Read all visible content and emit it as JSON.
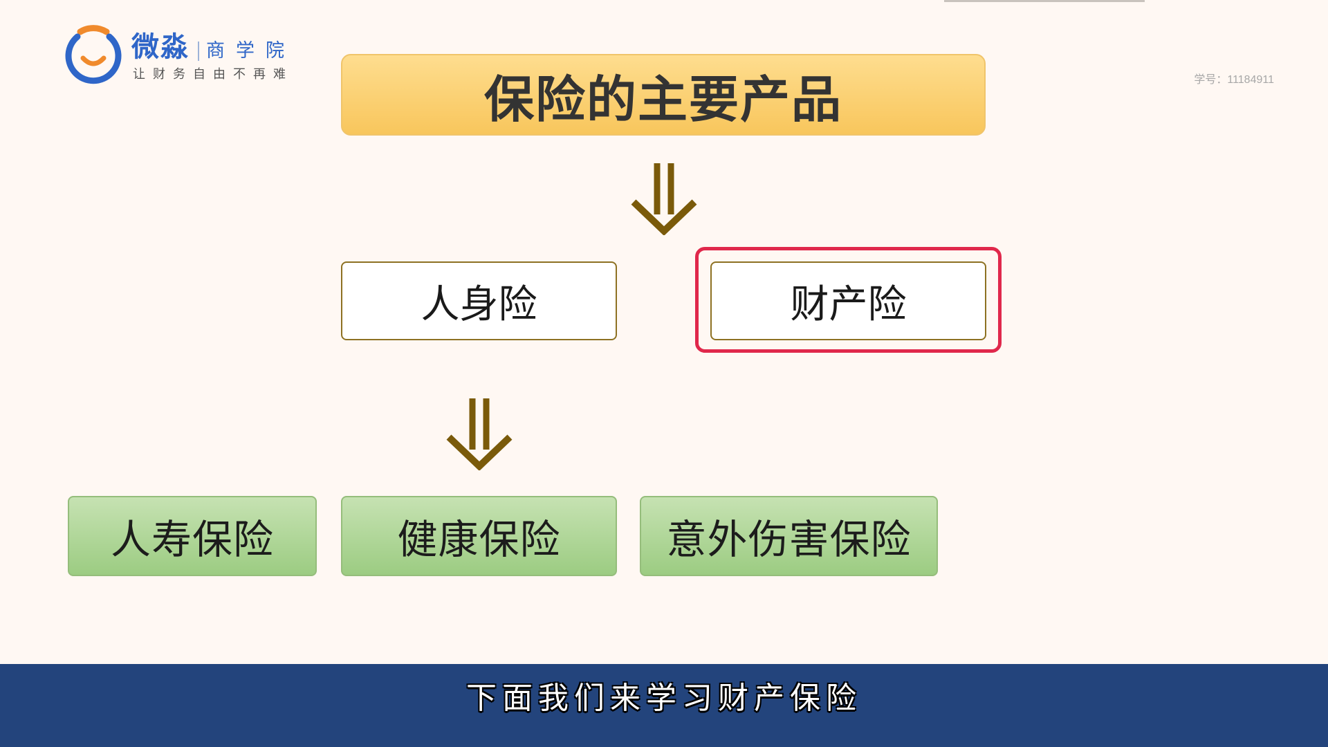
{
  "logo": {
    "name": "微淼",
    "sub": "商学院",
    "tagline": "让财务自由不再难",
    "colors": {
      "blue": "#2f66c8",
      "orange": "#f08a2c",
      "red": "#e8402c"
    }
  },
  "student_id": "学号：11184911",
  "title": "保险的主要产品",
  "categories": [
    {
      "label": "人身险",
      "highlighted": false
    },
    {
      "label": "财产险",
      "highlighted": true
    }
  ],
  "products": [
    "人寿保险",
    "健康保险",
    "意外伤害保险"
  ],
  "subtitle": "下面我们来学习财产保险",
  "colors": {
    "background": "#fff8f3",
    "title_box": "#fcd273",
    "box_border": "#8d7122",
    "arrow": "#7a5a0a",
    "highlight": "#e0284b",
    "product_box": "#b2d89a",
    "subtitle_bar": "#23447c"
  },
  "icons": {
    "logo_mark": "ring-smile-icon",
    "arrows": "double-down-arrow-icon"
  }
}
